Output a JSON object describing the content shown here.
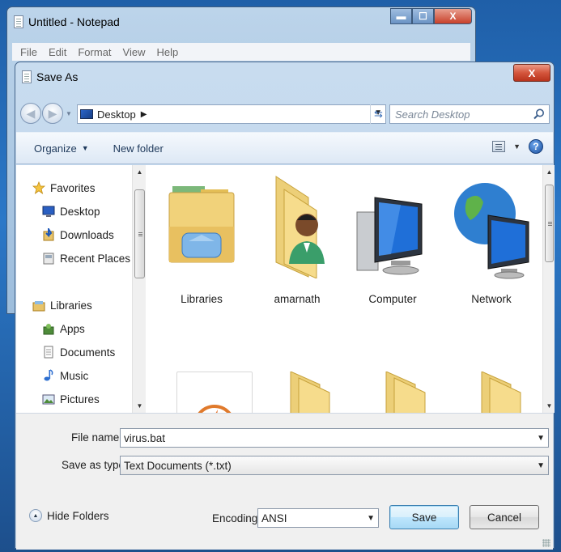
{
  "notepad": {
    "title": "Untitled - Notepad",
    "menu": [
      "File",
      "Edit",
      "Format",
      "View",
      "Help"
    ]
  },
  "dialog": {
    "title": "Save As",
    "close_glyph": "X",
    "address": {
      "location": "Desktop"
    },
    "search": {
      "placeholder": "Search Desktop"
    },
    "toolbar": {
      "organize": "Organize",
      "new_folder": "New folder",
      "help_glyph": "?"
    },
    "nav": {
      "favorites": "Favorites",
      "favorite_items": [
        "Desktop",
        "Downloads",
        "Recent Places"
      ],
      "libraries": "Libraries",
      "library_items": [
        "Apps",
        "Documents",
        "Music",
        "Pictures"
      ]
    },
    "files": [
      {
        "name": "Libraries",
        "icon": "libraries-folder-icon"
      },
      {
        "name": "amarnath",
        "icon": "user-folder-icon"
      },
      {
        "name": "Computer",
        "icon": "computer-icon"
      },
      {
        "name": "Network",
        "icon": "network-icon"
      },
      {
        "name": "",
        "icon": "app-shortcut-icon"
      },
      {
        "name": "",
        "icon": "folder-icon"
      },
      {
        "name": "",
        "icon": "folder-icon"
      },
      {
        "name": "",
        "icon": "folder-icon"
      }
    ],
    "form": {
      "file_name_label": "File name:",
      "file_name_value": "virus.bat",
      "save_type_label": "Save as type:",
      "save_type_value": "Text Documents (*.txt)",
      "encoding_label": "Encoding:",
      "encoding_value": "ANSI",
      "hide_folders": "Hide Folders",
      "save": "Save",
      "cancel": "Cancel"
    }
  }
}
